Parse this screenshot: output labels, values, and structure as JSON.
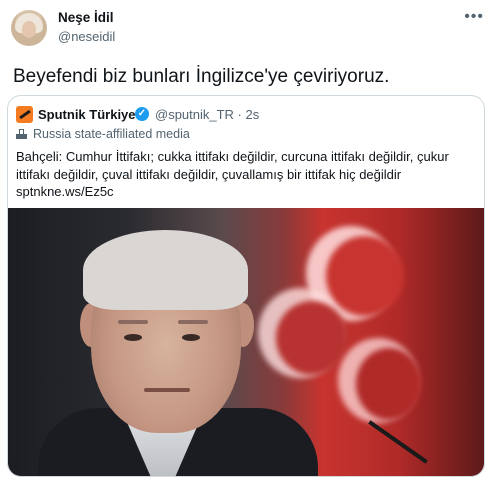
{
  "author": {
    "name": "Neşe İdil",
    "handle": "@neseidil"
  },
  "tweet": {
    "text": "Beyefendi biz bunları İngilizce'ye çeviriyoruz."
  },
  "more_icon": "more-horizontal-icon",
  "quoted": {
    "name": "Sputnik Türkiye",
    "verified_icon": "verified-badge-icon",
    "handle_time": "@sputnik_TR · 2s",
    "label": "Russia state-affiliated media",
    "text": "Bahçeli: Cumhur İttifakı; cukka ittifakı değildir, curcuna ittifakı değildir, çukur ittifakı değildir, çuval ittifakı değildir, çuvallamış bir ittifak hiç değildir",
    "link": "sptnkne.ws/Ez5c",
    "accent_color": "#1d9bf0",
    "logo_color": "#f47b20"
  }
}
